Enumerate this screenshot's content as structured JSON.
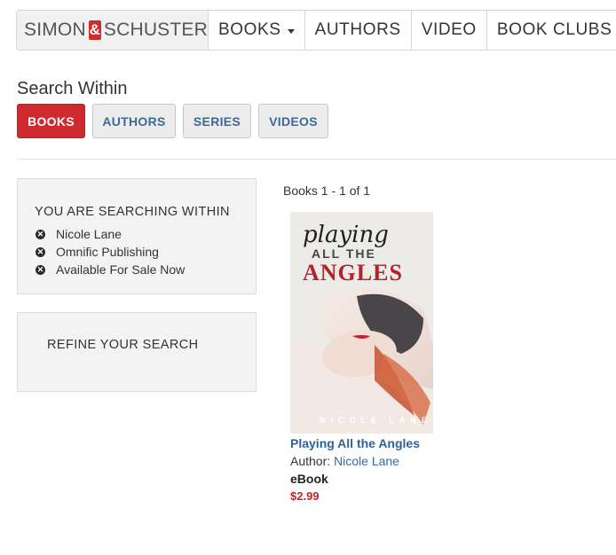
{
  "navbar": {
    "brand": {
      "left": "SIMON",
      "amp": "&",
      "right": "SCHUSTER"
    },
    "items": [
      {
        "label": "BOOKS",
        "dropdown": true
      },
      {
        "label": "AUTHORS"
      },
      {
        "label": "VIDEO"
      },
      {
        "label": "BOOK CLUBS"
      }
    ]
  },
  "search_within": {
    "title": "Search Within",
    "tabs": [
      "BOOKS",
      "AUTHORS",
      "SERIES",
      "VIDEOS"
    ],
    "active_tab": "BOOKS"
  },
  "searching_within": {
    "heading": "YOU ARE SEARCHING WITHIN",
    "filters": [
      "Nicole Lane",
      "Omnific Publishing",
      "Available For Sale Now"
    ]
  },
  "refine": {
    "heading": "REFINE YOUR SEARCH"
  },
  "results": {
    "count_text": "Books 1 - 1 of 1",
    "books": [
      {
        "cover_title_script": "playing",
        "cover_title_small": "ALL THE",
        "cover_title_big": "ANGLES",
        "cover_author": "NICOLE LANE",
        "title": "Playing All the Angles",
        "author_label": "Author:",
        "author": "Nicole Lane",
        "format": "eBook",
        "price": "$2.99"
      }
    ]
  },
  "colors": {
    "accent_red": "#cf2a2f",
    "link_blue": "#2f6198",
    "price_red": "#c0262d",
    "panel_bg": "#f3f3f3"
  }
}
